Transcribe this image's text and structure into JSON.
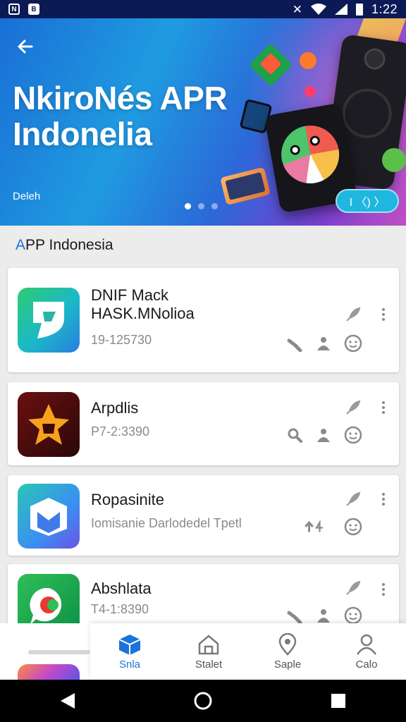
{
  "status_bar": {
    "left_icons": [
      "notification-icon-1",
      "notification-icon-2"
    ],
    "right_icons": [
      "no-sim-icon",
      "wifi-icon",
      "signal-icon",
      "battery-icon"
    ],
    "time": "1:22"
  },
  "hero": {
    "title_line1": "NkiroNés APR",
    "title_line2": "Indonelia",
    "subtitle": "Deleh",
    "pill_label": "I 〈) 〉",
    "carousel_dots": 3,
    "active_dot": 0
  },
  "section": {
    "title_first": "A",
    "title_rest": "PP Indonesia"
  },
  "apps": [
    {
      "name_line1": "DNIF Mack",
      "name_line2": "HASK.MNolioa",
      "meta": "19-125730",
      "icon": "shield-logo-icon",
      "actions": [
        "rocket-icon",
        "wrench-icon",
        "people-icon",
        "smile-icon"
      ]
    },
    {
      "name_line1": "Arpdlis",
      "name_line2": "",
      "meta": "P7-2:3390",
      "icon": "star-badge-icon",
      "actions": [
        "rocket-icon",
        "search-icon",
        "people-icon",
        "smile-icon"
      ]
    },
    {
      "name_line1": "Ropasinite",
      "name_line2": "",
      "meta": "Iomisanie Darlodedel Tpetl",
      "icon": "box-logo-icon",
      "actions": [
        "rocket-icon",
        "upload-icon",
        "smile-icon"
      ]
    },
    {
      "name_line1": "Abshlata",
      "name_line2": "",
      "meta": "T4-1:8390",
      "icon": "chat-bubble-icon",
      "actions": [
        "rocket-icon",
        "wrench-icon",
        "people-icon",
        "smile-icon"
      ]
    }
  ],
  "bottom_nav": [
    {
      "label": "Snla",
      "icon": "cube-icon",
      "active": true
    },
    {
      "label": "Stalet",
      "icon": "house-icon",
      "active": false
    },
    {
      "label": "Saple",
      "icon": "location-icon",
      "active": false
    },
    {
      "label": "Calo",
      "icon": "person-icon",
      "active": false
    }
  ],
  "colors": {
    "accent": "#1b74d9",
    "status_bar": "#0b1a55",
    "hero_start": "#1a6fd6",
    "hero_end": "#c14fc4"
  }
}
